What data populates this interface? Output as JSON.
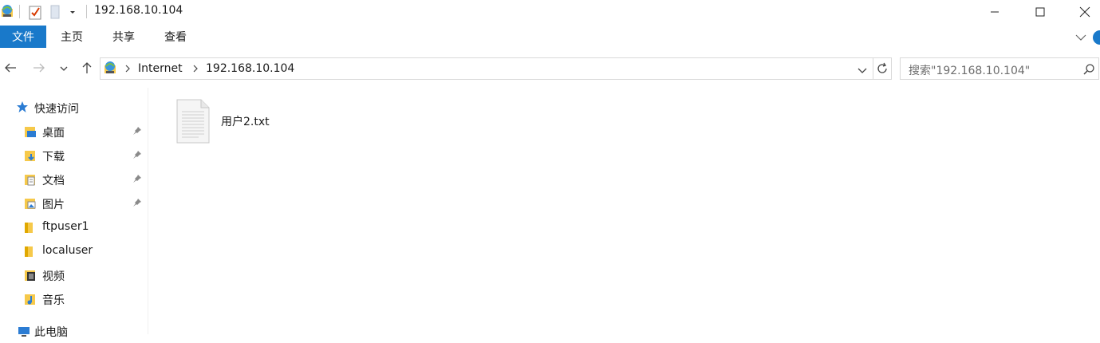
{
  "window": {
    "title": "192.168.10.104",
    "minimize": "minimize",
    "maximize": "maximize",
    "close": "close"
  },
  "ribbon": {
    "tabs": [
      "文件",
      "主页",
      "共享",
      "查看"
    ]
  },
  "address": {
    "segments": [
      "Internet",
      "192.168.10.104"
    ]
  },
  "search": {
    "placeholder": "搜索\"192.168.10.104\""
  },
  "navpane": {
    "quick_access": "快速访问",
    "items": [
      {
        "label": "桌面",
        "icon": "desktop-folder-icon",
        "pinned": true
      },
      {
        "label": "下载",
        "icon": "downloads-folder-icon",
        "pinned": true
      },
      {
        "label": "文档",
        "icon": "documents-folder-icon",
        "pinned": true
      },
      {
        "label": "图片",
        "icon": "pictures-folder-icon",
        "pinned": true
      },
      {
        "label": "ftpuser1",
        "icon": "folder-icon",
        "pinned": false
      },
      {
        "label": "localuser",
        "icon": "folder-icon",
        "pinned": false
      },
      {
        "label": "视频",
        "icon": "videos-folder-icon",
        "pinned": false
      },
      {
        "label": "音乐",
        "icon": "music-folder-icon",
        "pinned": false
      }
    ],
    "this_pc": "此电脑"
  },
  "content": {
    "files": [
      {
        "name": "用户2.txt",
        "icon": "text-file-icon"
      }
    ]
  },
  "colors": {
    "accent": "#1979ca",
    "folder": "#f6c94a"
  }
}
